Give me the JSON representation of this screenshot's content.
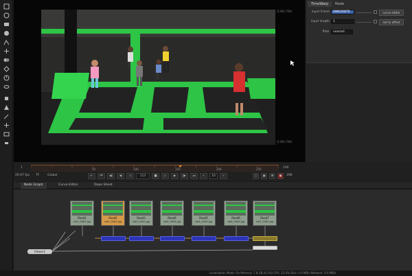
{
  "toolbar": {
    "tools": [
      "image-icon",
      "shape-icon",
      "channel-icon",
      "color-icon",
      "filter-icon",
      "keyer-icon",
      "merge-icon",
      "transform-icon",
      "time-icon",
      "views-icon",
      "other-icon",
      "gizmo-icon",
      "paint-icon",
      "move-icon",
      "file-icon",
      "settings-icon"
    ]
  },
  "viewer": {
    "coord_top_right": "(1366,768)",
    "coord_bottom_right": "(1366,768)",
    "coord_bottom_left": "(0,0)"
  },
  "properties": {
    "tabs": [
      "TimeWarp",
      "Node"
    ],
    "input_frame_label": "input frame",
    "input_frame_value": "SWK26870",
    "input_length_label": "input length",
    "input_length_value": "1",
    "filter_label": "filter",
    "filter_value": "nearest",
    "curve_editor_button": "curve editor",
    "set_to_offset_button": "set to offset"
  },
  "timeline": {
    "start_frame": "1",
    "end_frame": "296",
    "end_frame_2": "296",
    "tick_labels": [
      "1",
      "50",
      "100",
      "150",
      "200",
      "250"
    ],
    "fps": "29.97 fps",
    "tf_label": "TF",
    "global_label": "Global",
    "current_frame": "113",
    "increment": "10"
  },
  "bottom_tabs": [
    "Node Graph",
    "Curve Editor",
    "Dope Sheet"
  ],
  "nodes": [
    {
      "name": "Read1",
      "file": "vid1_0005.jpg"
    },
    {
      "name": "Read2",
      "file": "vid2_0005.jpg"
    },
    {
      "name": "Read3",
      "file": "vid3_0005.jpg"
    },
    {
      "name": "Read4",
      "file": "vid4_0005.jpg"
    },
    {
      "name": "Read5",
      "file": "vid5_0005.jpg"
    },
    {
      "name": "Read6",
      "file": "vid6_0005.jpg"
    },
    {
      "name": "Read7",
      "file": "vid7_0005.jpg"
    }
  ],
  "viewer_node": "Viewer1",
  "status_bar": "Localization Mode: On   Memory: 7.8 GB (6.3%)   CPU: 12.0%   Disk: 0.0 MB/s   Network: 0.0 MB/s",
  "colors": {
    "accent": "#d68a3a",
    "selected_field": "#3b61a8",
    "timewarp_node": "#2b34b8",
    "trampoline_green": "#2ec445"
  }
}
